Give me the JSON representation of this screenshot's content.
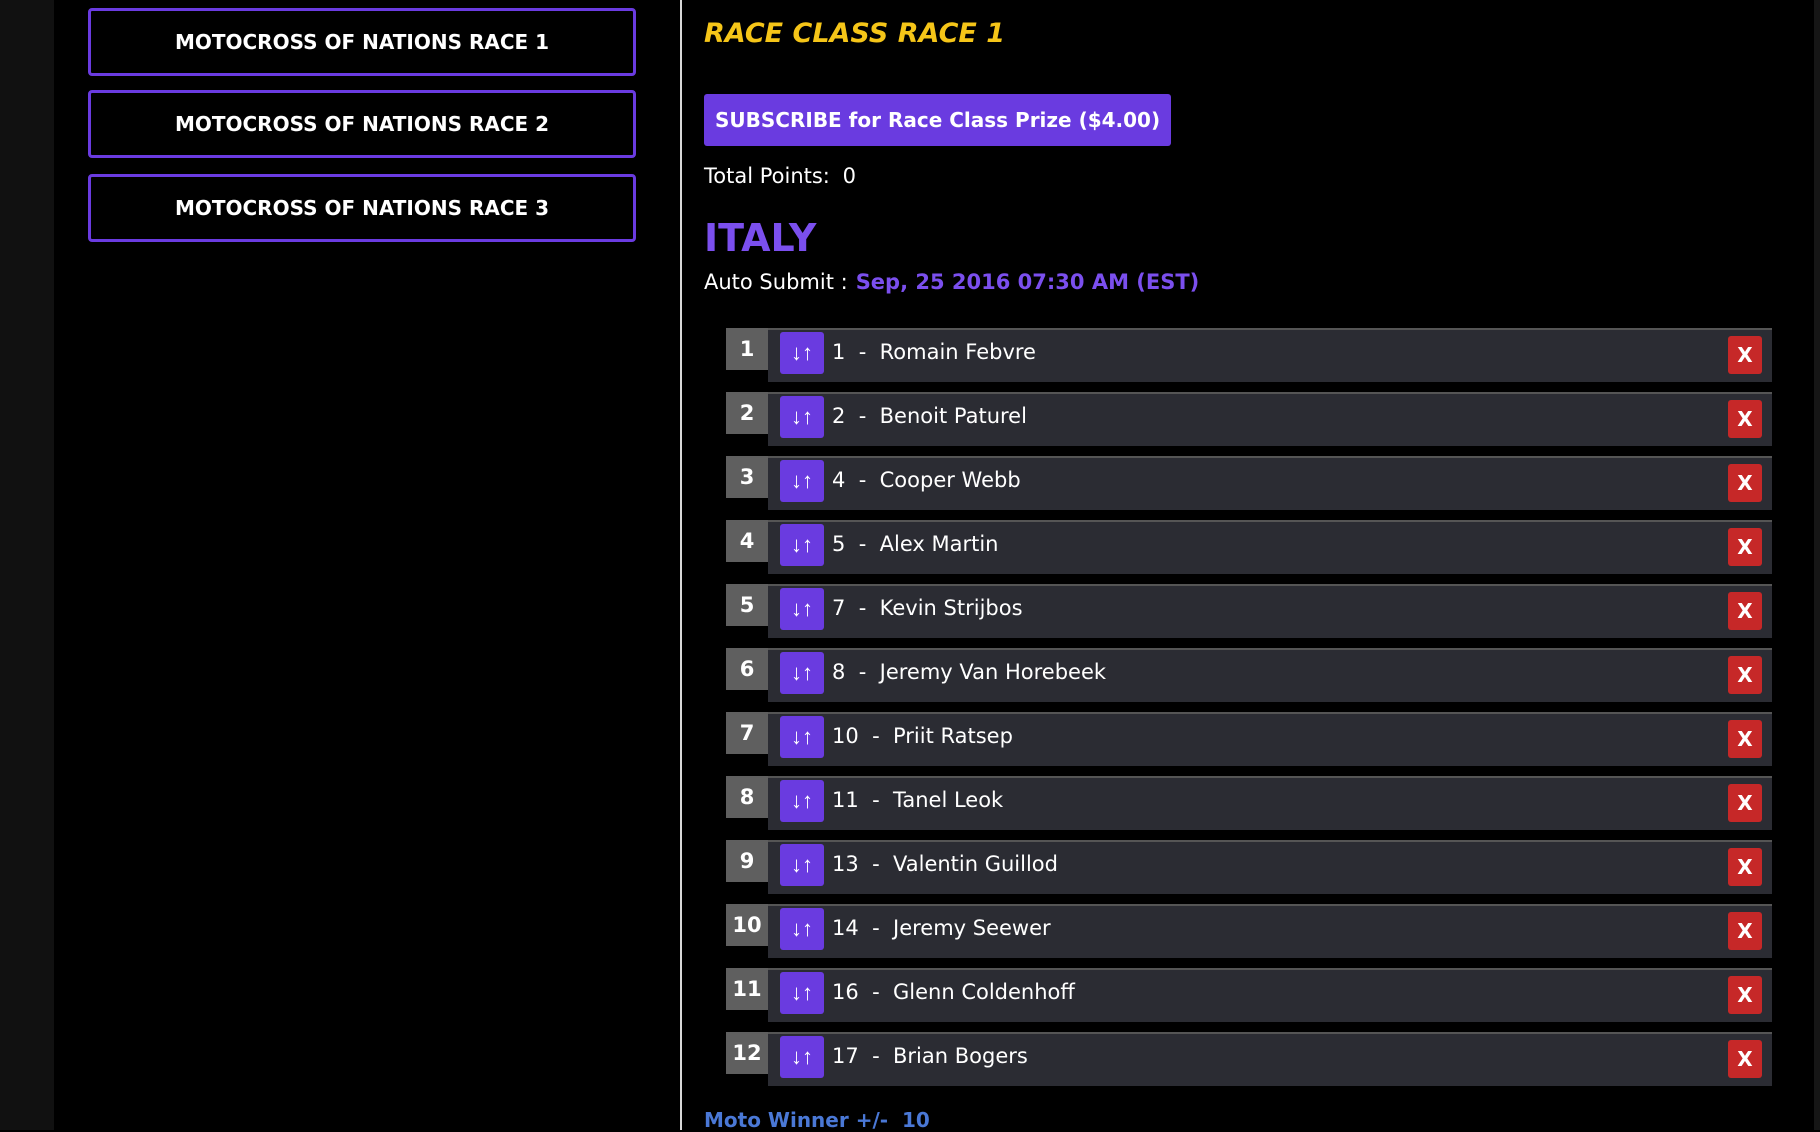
{
  "sidebar": {
    "races": [
      {
        "label": "MOTOCROSS OF NATIONS RACE 1"
      },
      {
        "label": "MOTOCROSS OF NATIONS RACE 2"
      },
      {
        "label": "MOTOCROSS OF NATIONS RACE 3"
      }
    ]
  },
  "main": {
    "race_title": "RACE CLASS RACE 1",
    "subscribe_label": "SUBSCRIBE for Race Class Prize ($4.00)",
    "total_points_label": "Total Points:",
    "total_points_value": "0",
    "country": "ITALY",
    "auto_submit_label": "Auto Submit :",
    "auto_submit_date": "Sep, 25 2016 07:30 AM (EST)",
    "sort_icon": "↓↑",
    "remove_label": "X",
    "picks": [
      {
        "rank": "1",
        "rider": "1  -  Romain Febvre"
      },
      {
        "rank": "2",
        "rider": "2  -  Benoit Paturel"
      },
      {
        "rank": "3",
        "rider": "4  -  Cooper Webb"
      },
      {
        "rank": "4",
        "rider": "5  -  Alex Martin"
      },
      {
        "rank": "5",
        "rider": "7  -  Kevin Strijbos"
      },
      {
        "rank": "6",
        "rider": "8  -  Jeremy Van Horebeek"
      },
      {
        "rank": "7",
        "rider": "10  -  Priit Ratsep"
      },
      {
        "rank": "8",
        "rider": "11  -  Tanel Leok"
      },
      {
        "rank": "9",
        "rider": "13  -  Valentin Guillod"
      },
      {
        "rank": "10",
        "rider": "14  -  Jeremy Seewer"
      },
      {
        "rank": "11",
        "rider": "16  -  Glenn Coldenhoff"
      },
      {
        "rank": "12",
        "rider": "17  -  Brian Bogers"
      }
    ],
    "moto_winner_label": "Moto Winner +/-  10"
  },
  "colors": {
    "accent_purple": "#6a3be0",
    "title_yellow": "#f5c518",
    "remove_red": "#c62828",
    "row_bg": "#2b2c33"
  }
}
